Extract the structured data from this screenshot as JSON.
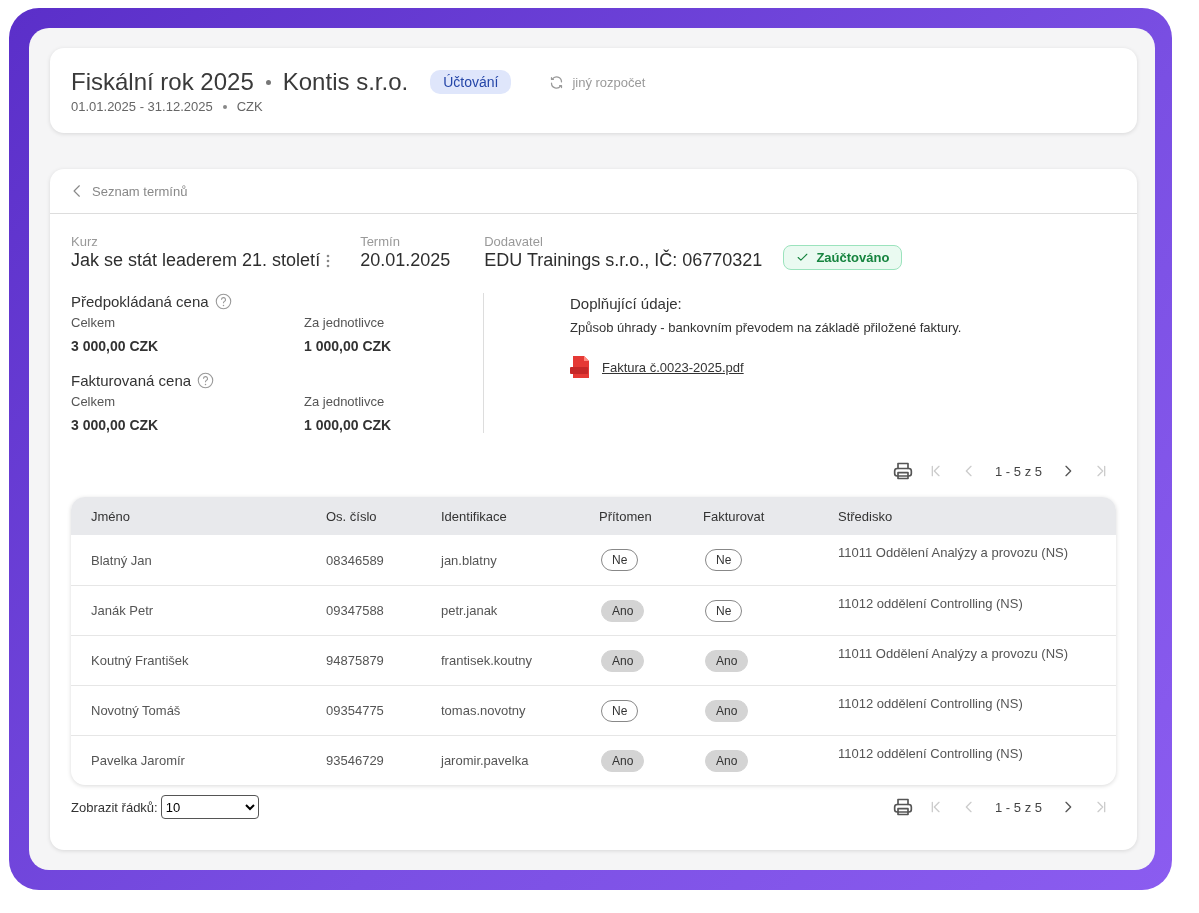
{
  "header": {
    "title": "Fiskální rok 2025",
    "company": "Kontis s.r.o.",
    "badge": "Účtování",
    "period": "01.01.2025 - 31.12.2025",
    "currency": "CZK",
    "switch_link": "jiný rozpočet"
  },
  "breadcrumb": {
    "back_label": "Seznam termínů"
  },
  "course": {
    "fields": [
      {
        "kind": "menu",
        "label": "Kurz",
        "value": "Jak se stát leaderem 21. století"
      },
      {
        "kind": "plain",
        "label": "Termín",
        "value": "20.01.2025"
      },
      {
        "kind": "plain",
        "label": "Dodavatel",
        "value": "EDU Trainings s.r.o., IČ: 06770321"
      }
    ],
    "status": "Zaúčtováno"
  },
  "prices": [
    {
      "title": "Předpokládaná cena",
      "columns": [
        {
          "label": "Celkem",
          "value": "3 000,00 CZK"
        },
        {
          "label": "Za jednotlivce",
          "value": "1 000,00 CZK"
        }
      ]
    },
    {
      "title": "Fakturovaná cena",
      "columns": [
        {
          "label": "Celkem",
          "value": "3 000,00 CZK"
        },
        {
          "label": "Za jednotlivce",
          "value": "1 000,00 CZK"
        }
      ]
    }
  ],
  "additional": {
    "title": "Doplňující údaje:",
    "text": "Způsob úhrady - bankovním převodem na základě přiložené faktury.",
    "attachment": "Faktura č.0023-2025.pdf"
  },
  "pager_top": {
    "range": "1 - 5 z 5",
    "first_disabled": true,
    "prev_disabled": true,
    "next_disabled": false,
    "last_disabled": true
  },
  "table": {
    "columns": [
      "Jméno",
      "Os. číslo",
      "Identifikace",
      "Přítomen",
      "Fakturovat",
      "Středisko"
    ],
    "rows": [
      {
        "name": "Blatný Jan",
        "number": "08346589",
        "login": "jan.blatny",
        "present": {
          "label": "Ne",
          "on": false
        },
        "invoice": {
          "label": "Ne",
          "on": false
        },
        "center": "11011 Oddělení Analýzy a provozu (NS)"
      },
      {
        "name": "Janák Petr",
        "number": "09347588",
        "login": "petr.janak",
        "present": {
          "label": "Ano",
          "on": true
        },
        "invoice": {
          "label": "Ne",
          "on": false
        },
        "center": "11012 oddělení Controlling (NS)"
      },
      {
        "name": "Koutný František",
        "number": "94875879",
        "login": "frantisek.koutny",
        "present": {
          "label": "Ano",
          "on": true
        },
        "invoice": {
          "label": "Ano",
          "on": true
        },
        "center": "11011 Oddělení Analýzy a provozu (NS)"
      },
      {
        "name": "Novotný Tomáš",
        "number": "09354775",
        "login": "tomas.novotny",
        "present": {
          "label": "Ne",
          "on": false
        },
        "invoice": {
          "label": "Ano",
          "on": true
        },
        "center": "11012 oddělení Controlling (NS)"
      },
      {
        "name": "Pavelka Jaromír",
        "number": "93546729",
        "login": "jaromir.pavelka",
        "present": {
          "label": "Ano",
          "on": true
        },
        "invoice": {
          "label": "Ano",
          "on": true
        },
        "center": "11012 oddělení Controlling (NS)"
      }
    ]
  },
  "rows_select": {
    "label": "Zobrazit řádků:",
    "value": "10"
  },
  "pager_bottom": {
    "range": "1 - 5 z 5",
    "first_disabled": true,
    "prev_disabled": true,
    "next_disabled": false,
    "last_disabled": true
  }
}
